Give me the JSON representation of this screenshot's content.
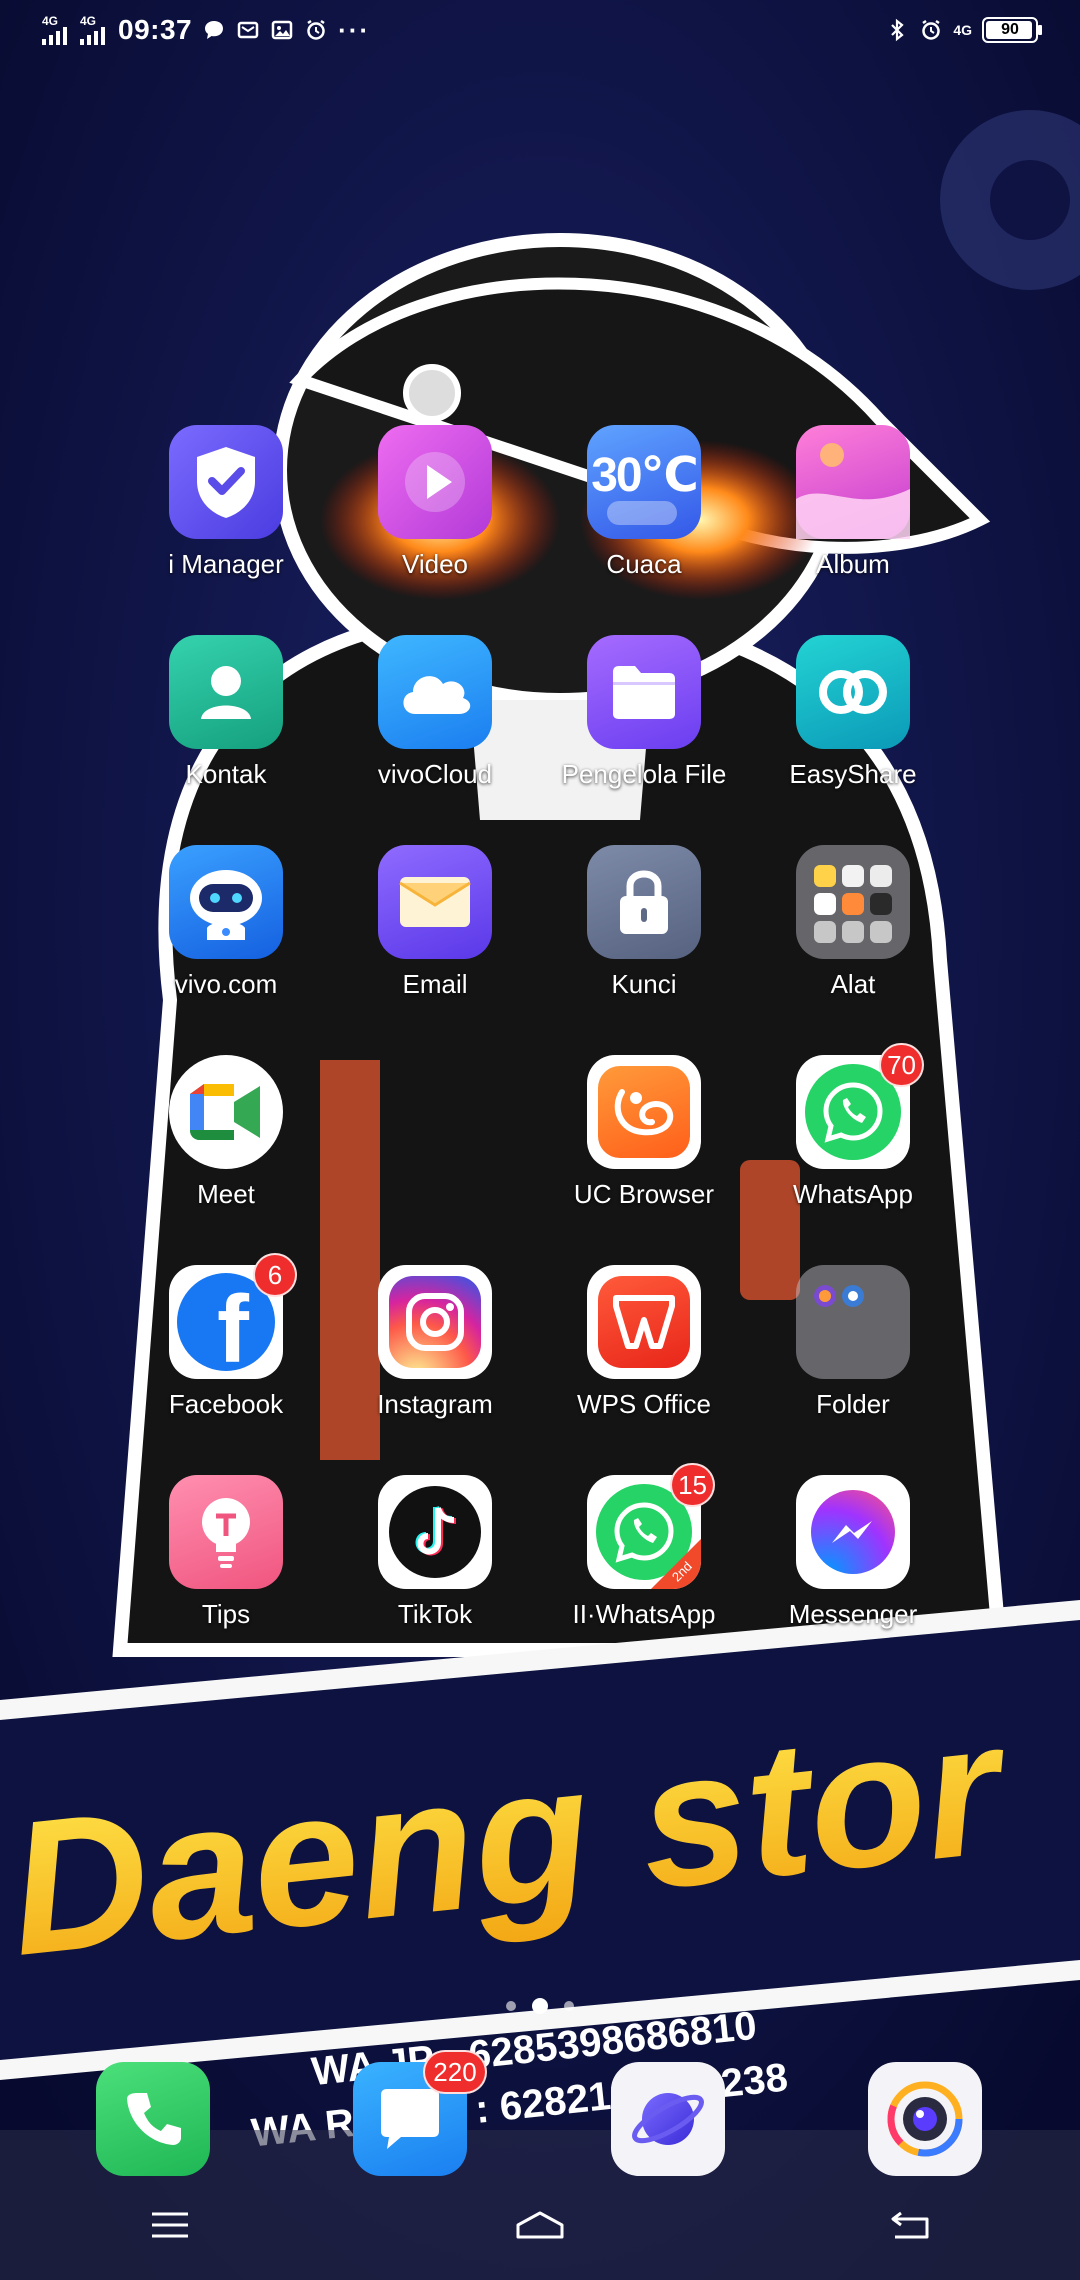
{
  "status_bar": {
    "network_1": "4G",
    "network_2": "4G",
    "time": "09:37",
    "notification_icons": [
      "chat-bubble-icon",
      "mail-icon",
      "gallery-icon",
      "alarm-icon"
    ],
    "more": "···",
    "right_icons": [
      "bluetooth-icon",
      "alarm-icon"
    ],
    "network_3": "4G",
    "battery": "90"
  },
  "apps": [
    {
      "label": "i Manager",
      "icon": "shield-check-icon"
    },
    {
      "label": "Video",
      "icon": "play-icon"
    },
    {
      "label": "Cuaca",
      "icon": "weather-icon",
      "icon_text": "30℃"
    },
    {
      "label": "Album",
      "icon": "album-icon"
    },
    {
      "label": "Kontak",
      "icon": "contact-icon"
    },
    {
      "label": "vivoCloud",
      "icon": "cloud-icon"
    },
    {
      "label": "Pengelola File",
      "icon": "folder-icon"
    },
    {
      "label": "EasyShare",
      "icon": "link-rings-icon"
    },
    {
      "label": "vivo.com",
      "icon": "robot-icon"
    },
    {
      "label": "Email",
      "icon": "envelope-icon"
    },
    {
      "label": "Kunci",
      "icon": "lock-icon"
    },
    {
      "label": "Alat",
      "icon": "tools-folder-icon"
    },
    {
      "label": "Meet",
      "icon": "meet-icon"
    },
    {
      "label": "UC Browser",
      "icon": "uc-browser-icon"
    },
    {
      "label": "WhatsApp",
      "icon": "whatsapp-icon",
      "badge": "70"
    },
    {
      "label": "Facebook",
      "icon": "facebook-icon",
      "badge": "6"
    },
    {
      "label": "Instagram",
      "icon": "instagram-icon"
    },
    {
      "label": "WPS Office",
      "icon": "wps-icon"
    },
    {
      "label": "Folder",
      "icon": "folder-group-icon"
    },
    {
      "label": "Tips",
      "icon": "bulb-icon"
    },
    {
      "label": "TikTok",
      "icon": "tiktok-icon"
    },
    {
      "label": "II·WhatsApp",
      "icon": "whatsapp-clone-icon",
      "badge": "15",
      "corner_text": "2nd"
    },
    {
      "label": "Messenger",
      "icon": "messenger-icon"
    }
  ],
  "page_indicator": {
    "pages": 3,
    "current": 2
  },
  "dock": [
    {
      "name": "phone",
      "icon": "phone-icon"
    },
    {
      "name": "messages",
      "icon": "message-icon",
      "badge": "220"
    },
    {
      "name": "browser",
      "icon": "planet-icon"
    },
    {
      "name": "camera",
      "icon": "camera-icon"
    }
  ],
  "nav_bar": [
    "menu-icon",
    "home-icon",
    "back-icon"
  ],
  "wallpaper": {
    "banner_text": "Daeng stor",
    "line_1": "WA JP : 6285398686810",
    "line_2": "WA REKER : 6282194449238"
  },
  "colors": {
    "badge": "#f02d2d",
    "background": "#0b0f3c",
    "banner_yellow": "#f7c21a"
  }
}
